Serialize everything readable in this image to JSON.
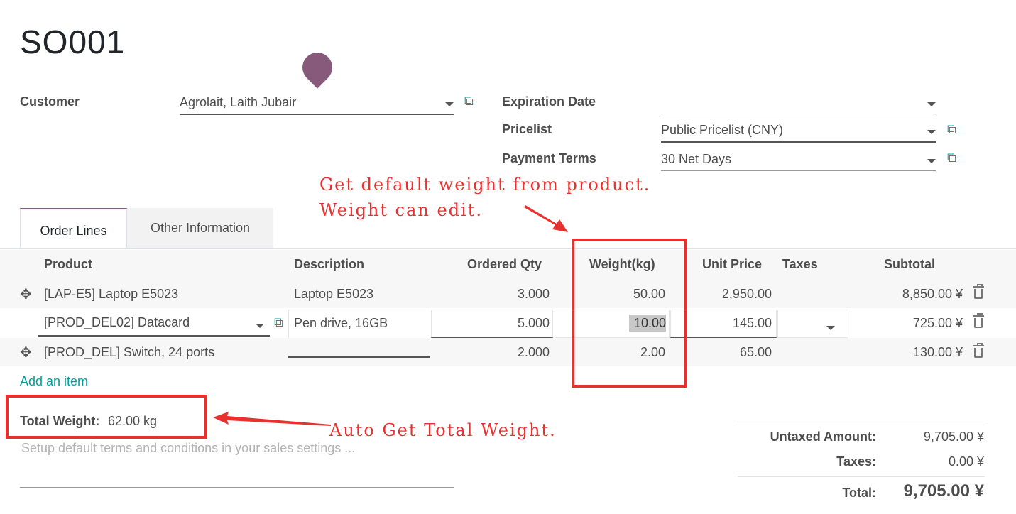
{
  "record": {
    "title": "SO001"
  },
  "form": {
    "customer_label": "Customer",
    "customer_value": "Agrolait, Laith Jubair",
    "expiration_label": "Expiration Date",
    "expiration_value": "",
    "pricelist_label": "Pricelist",
    "pricelist_value": "Public Pricelist (CNY)",
    "payment_terms_label": "Payment Terms",
    "payment_terms_value": "30 Net Days",
    "external_link_icon": "⧉"
  },
  "tabs": [
    {
      "label": "Order Lines",
      "active": true
    },
    {
      "label": "Other Information",
      "active": false
    }
  ],
  "table": {
    "headers": {
      "product": "Product",
      "description": "Description",
      "qty": "Ordered Qty",
      "weight": "Weight(kg)",
      "price": "Unit Price",
      "taxes": "Taxes",
      "subtotal": "Subtotal"
    },
    "rows": [
      {
        "product": "[LAP-E5] Laptop E5023",
        "description": "Laptop E5023",
        "qty": "3.000",
        "weight": "50.00",
        "price": "2,950.00",
        "taxes": "",
        "subtotal": "8,850.00 ¥"
      },
      {
        "product": "[PROD_DEL02] Datacard",
        "description": "Pen drive, 16GB",
        "qty": "5.000",
        "weight": "10.00",
        "price": "145.00",
        "taxes": "",
        "subtotal": "725.00 ¥"
      },
      {
        "product": "[PROD_DEL] Switch, 24 ports",
        "description": "",
        "qty": "2.000",
        "weight": "2.00",
        "price": "65.00",
        "taxes": "",
        "subtotal": "130.00 ¥"
      }
    ],
    "add_item": "Add an item"
  },
  "footer": {
    "total_weight_label": "Total Weight:",
    "total_weight_value": "62.00 kg",
    "terms_placeholder": "Setup default terms and conditions in your sales settings ...",
    "untaxed_label": "Untaxed Amount:",
    "untaxed_value": "9,705.00 ¥",
    "taxes_label": "Taxes:",
    "taxes_value": "0.00 ¥",
    "total_label": "Total:",
    "total_value": "9,705.00 ¥"
  },
  "annotations": {
    "note1_line1": "Get default weight from product.",
    "note1_line2": "Weight can edit.",
    "note2": "Auto Get Total Weight.",
    "color": "#e8312f"
  },
  "colors": {
    "brand": "#875a7b",
    "link": "#00a09d"
  }
}
